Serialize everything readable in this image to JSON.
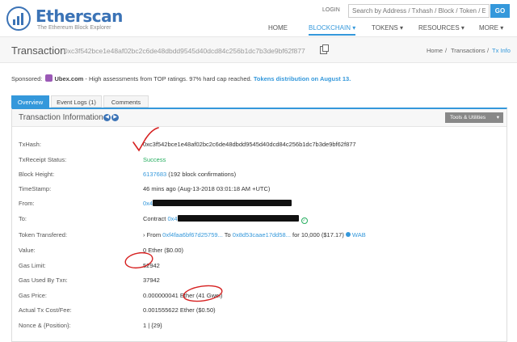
{
  "header": {
    "logo_title": "Etherscan",
    "logo_subtitle": "The Ethereum Block Explorer",
    "login_label": "LOGIN",
    "search_placeholder": "Search by Address / Txhash / Block / Token / Ens",
    "go_label": "GO",
    "nav": [
      "HOME",
      "BLOCKCHAIN",
      "TOKENS",
      "RESOURCES",
      "MORE"
    ],
    "active_nav": "BLOCKCHAIN"
  },
  "subheader": {
    "title": "Transaction",
    "hash": "0xc3f542bce1e48af02bc2c6de48dbdd9545d40dcd84c256b1dc7b3de9bf62f877",
    "breadcrumb": [
      "Home",
      "Transactions",
      "Tx Info"
    ]
  },
  "sponsored": {
    "label": "Sponsored:",
    "brand": "Ubex.com",
    "text": " - High assessments from TOP ratings. 97% hard cap reached. ",
    "link": "Tokens distribution on August 13."
  },
  "tabs": [
    "Overview",
    "Event Logs (1)",
    "Comments"
  ],
  "panel": {
    "title": "Transaction Information",
    "tools_label": "Tools & Utilities",
    "rows": {
      "txhash": {
        "label": "TxHash:",
        "value": "0xc3f542bce1e48af02bc2c6de48dbdd9545d40dcd84c256b1dc7b3de9bf62f877"
      },
      "status": {
        "label": "TxReceipt Status:",
        "value": "Success"
      },
      "block": {
        "label": "Block Height:",
        "value": "6137683",
        "extra": " (192 block confirmations)"
      },
      "timestamp": {
        "label": "TimeStamp:",
        "value": "46 mins ago (Aug-13-2018 03:01:18 AM +UTC)"
      },
      "from": {
        "label": "From:",
        "value": "0x4"
      },
      "to": {
        "label": "To:",
        "prefix": "Contract ",
        "value": "0x4"
      },
      "token": {
        "label": "Token Transfered:",
        "from_label": "› From ",
        "from": "0xf4faa6bf67d25759...",
        "to_label": " To ",
        "to": "0x8d53caae17dd58...",
        "for_text": " for  10,000 ($17.17) ",
        "token_name": "WAB"
      },
      "value": {
        "label": "Value:",
        "value": "0 Ether ($0.00)"
      },
      "gaslimit": {
        "label": "Gas Limit:",
        "value": "52942"
      },
      "gasused": {
        "label": "Gas Used By Txn:",
        "value": "37942"
      },
      "gasprice": {
        "label": "Gas Price:",
        "value": "0.000000041 Ether (41 Gwei)"
      },
      "cost": {
        "label": "Actual Tx Cost/Fee:",
        "value": "0.001555622 Ether ($0.50)"
      },
      "nonce": {
        "label": "Nonce & {Position}:",
        "value": "1 | {29}"
      }
    }
  },
  "colors": {
    "accent": "#3498db",
    "success": "#27ae60",
    "annotation": "#d62020"
  }
}
